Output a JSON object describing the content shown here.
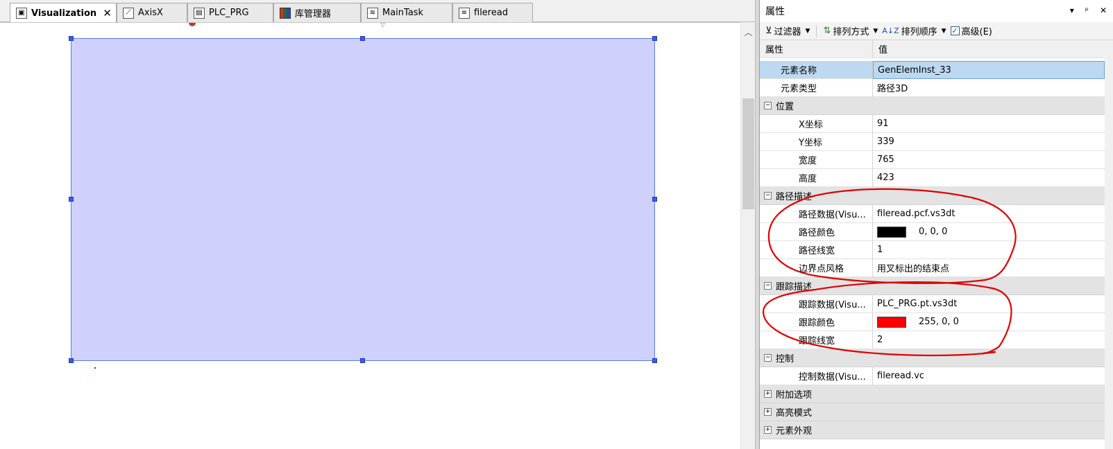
{
  "tabs": [
    {
      "label": "Visualization",
      "icon": "visualization-icon",
      "active": true
    },
    {
      "label": "AxisX",
      "icon": "axis-icon"
    },
    {
      "label": "PLC_PRG",
      "icon": "program-icon"
    },
    {
      "label": "库管理器",
      "icon": "library-icon"
    },
    {
      "label": "MainTask",
      "icon": "task-icon"
    },
    {
      "label": "fileread",
      "icon": "document-icon"
    }
  ],
  "tab_close": "✕",
  "props": {
    "title": "属性",
    "title_buttons": [
      "▾",
      "ᵖ",
      "✕"
    ],
    "toolbar": {
      "filter": "过滤器",
      "sort_by": "排列方式",
      "sort_order": "排列顺序",
      "advanced": "高级(E)"
    },
    "header": {
      "col1": "属性",
      "col2": "值"
    },
    "rows": {
      "element_name": {
        "label": "元素名称",
        "value": "GenElemInst_33"
      },
      "element_type": {
        "label": "元素类型",
        "value": "路径3D"
      },
      "position": {
        "label": "位置"
      },
      "x": {
        "label": "X坐标",
        "value": "91"
      },
      "y": {
        "label": "Y坐标",
        "value": "339"
      },
      "width": {
        "label": "宽度",
        "value": "765"
      },
      "height": {
        "label": "高度",
        "value": "423"
      },
      "path_desc": {
        "label": "路径描述"
      },
      "path_data": {
        "label": "路径数据(Visu...",
        "value": "fileread.pcf.vs3dt"
      },
      "path_color": {
        "label": "路径颜色",
        "value": "0, 0, 0",
        "color": "#000000"
      },
      "path_width": {
        "label": "路径线宽",
        "value": "1"
      },
      "border_style": {
        "label": "边界点风格",
        "value": "用叉标出的结束点"
      },
      "trace_desc": {
        "label": "跟踪描述"
      },
      "trace_data": {
        "label": "跟踪数据(Visu...",
        "value": "PLC_PRG.pt.vs3dt"
      },
      "trace_color": {
        "label": "跟踪颜色",
        "value": "255, 0, 0",
        "color": "#ff0000"
      },
      "trace_width": {
        "label": "跟踪线宽",
        "value": "2"
      },
      "control": {
        "label": "控制"
      },
      "control_data": {
        "label": "控制数据(Visu...",
        "value": "fileread.vc"
      },
      "extra_options": {
        "label": "附加选项"
      },
      "highlight_mode": {
        "label": "高亮模式"
      },
      "appearance": {
        "label": "元素外观"
      }
    }
  },
  "colors": {
    "element_fill": "#cfd0fb",
    "selection": "#bcd9f1",
    "annotation": "#e00000"
  }
}
